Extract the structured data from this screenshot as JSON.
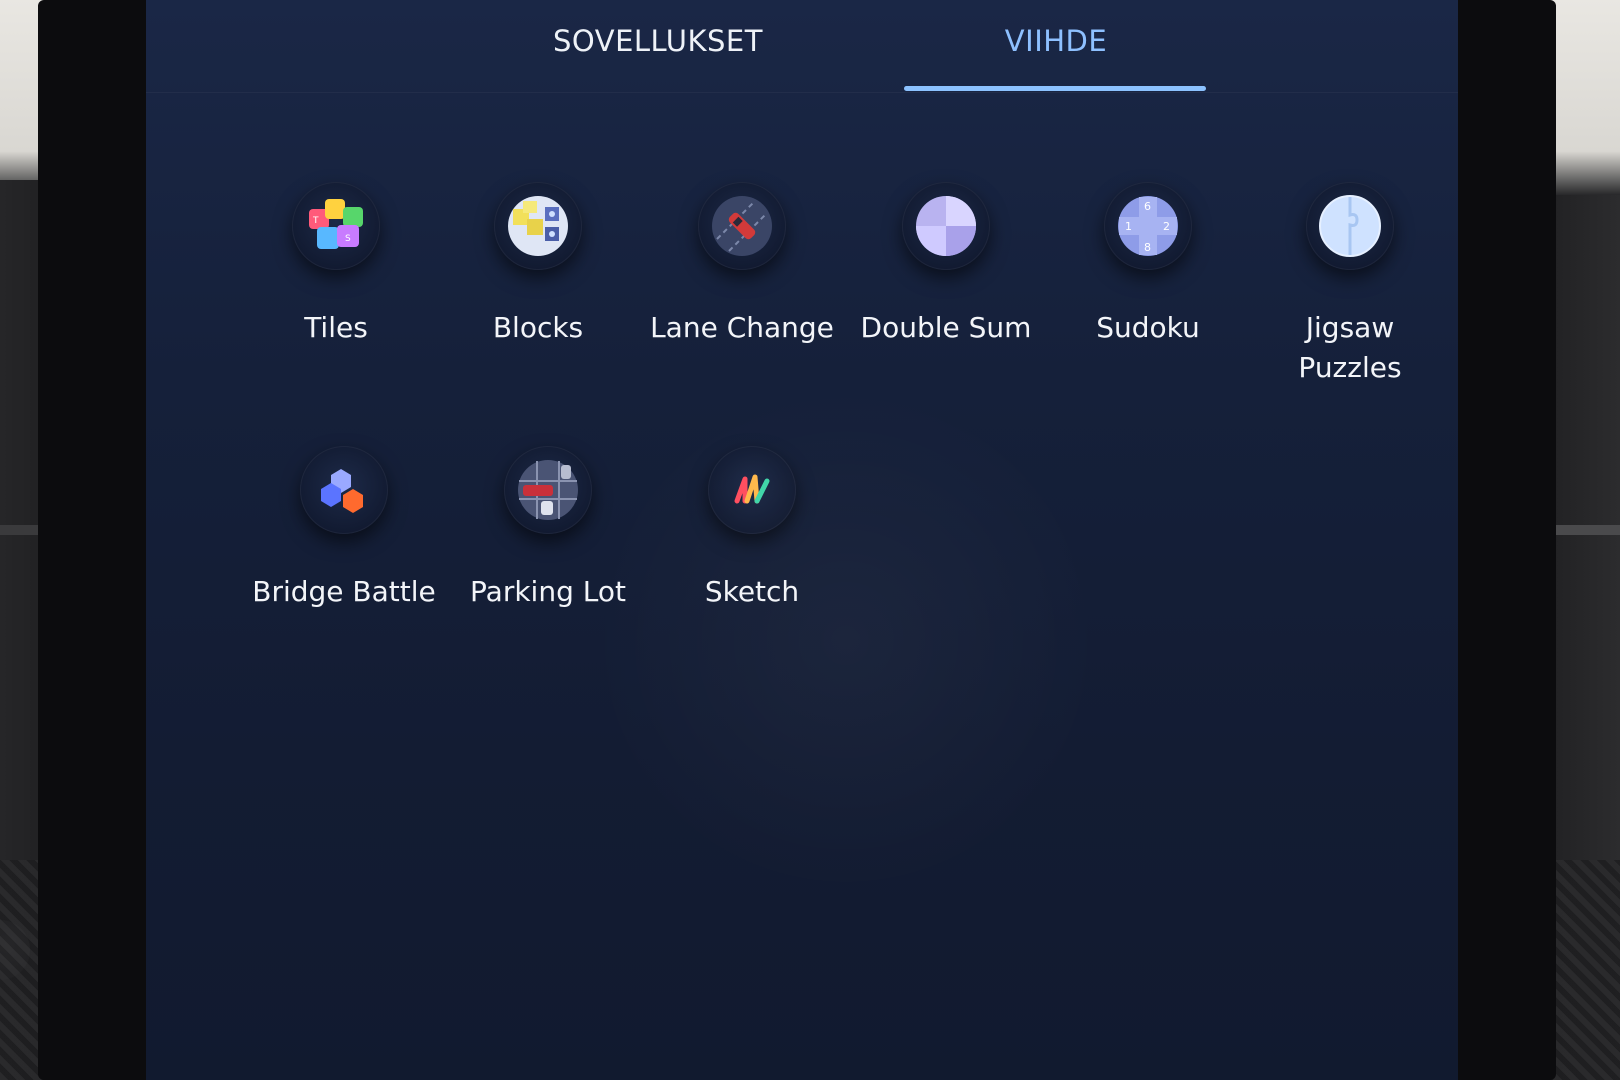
{
  "tabs": [
    {
      "label": "SOVELLUKSET",
      "active": false
    },
    {
      "label": "VIIHDE",
      "active": true
    }
  ],
  "colors": {
    "screen_bg": "#15203a",
    "active_tab": "#8ec0ff",
    "label_text": "#f3f5f9"
  },
  "apps": [
    {
      "label": "Tiles",
      "icon": "tiles-icon"
    },
    {
      "label": "Blocks",
      "icon": "blocks-icon"
    },
    {
      "label": "Lane Change",
      "icon": "lane-change-icon"
    },
    {
      "label": "Double Sum",
      "icon": "double-sum-icon"
    },
    {
      "label": "Sudoku",
      "icon": "sudoku-icon"
    },
    {
      "label": "Jigsaw Puzzles",
      "icon": "jigsaw-icon"
    },
    {
      "label": "Bridge Battle",
      "icon": "bridge-battle-icon"
    },
    {
      "label": "Parking Lot",
      "icon": "parking-lot-icon"
    },
    {
      "label": "Sketch",
      "icon": "sketch-icon"
    }
  ],
  "sudoku_digits": [
    "6",
    "1",
    "2",
    "8"
  ]
}
